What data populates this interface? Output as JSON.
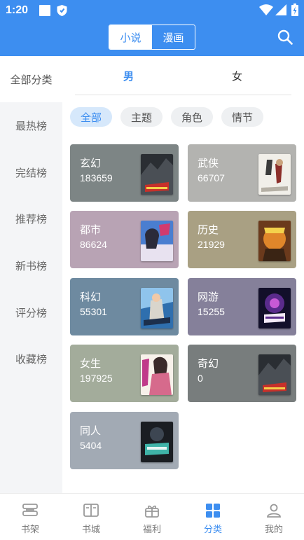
{
  "status_bar": {
    "time": "1:20"
  },
  "header": {
    "segments": [
      {
        "label": "小说",
        "active": true
      },
      {
        "label": "漫画",
        "active": false
      }
    ],
    "search_icon": "search-icon"
  },
  "sidebar": {
    "all_label": "全部分类",
    "items": [
      {
        "label": "最热榜"
      },
      {
        "label": "完结榜"
      },
      {
        "label": "推荐榜"
      },
      {
        "label": "新书榜"
      },
      {
        "label": "评分榜"
      },
      {
        "label": "收藏榜"
      }
    ]
  },
  "gender_tabs": [
    {
      "label": "男",
      "active": true
    },
    {
      "label": "女",
      "active": false
    }
  ],
  "filters": [
    {
      "label": "全部",
      "active": true
    },
    {
      "label": "主题",
      "active": false
    },
    {
      "label": "角色",
      "active": false
    },
    {
      "label": "情节",
      "active": false
    }
  ],
  "categories": [
    {
      "name": "玄幻",
      "count": "183659",
      "color": "#7d8585"
    },
    {
      "name": "武侠",
      "count": "66707",
      "color": "#b3b3b0"
    },
    {
      "name": "都市",
      "count": "86624",
      "color": "#b8a3b4"
    },
    {
      "name": "历史",
      "count": "21929",
      "color": "#a9a083"
    },
    {
      "name": "科幻",
      "count": "55301",
      "color": "#6e8aa0"
    },
    {
      "name": "网游",
      "count": "15255",
      "color": "#85809a"
    },
    {
      "name": "女生",
      "count": "197925",
      "color": "#a3ac9b"
    },
    {
      "name": "奇幻",
      "count": "0",
      "color": "#787d7d"
    },
    {
      "name": "同人",
      "count": "5404",
      "color": "#a2aab4"
    }
  ],
  "bottom_nav": [
    {
      "label": "书架",
      "icon": "bookshelf-icon",
      "active": false
    },
    {
      "label": "书城",
      "icon": "book-open-icon",
      "active": false
    },
    {
      "label": "福利",
      "icon": "gift-icon",
      "active": false
    },
    {
      "label": "分类",
      "icon": "grid-icon",
      "active": true
    },
    {
      "label": "我的",
      "icon": "user-icon",
      "active": false
    }
  ],
  "colors": {
    "accent": "#3d8ef0",
    "header_bg": "#3d8ef0",
    "sidebar_bg": "#f4f5f7"
  }
}
